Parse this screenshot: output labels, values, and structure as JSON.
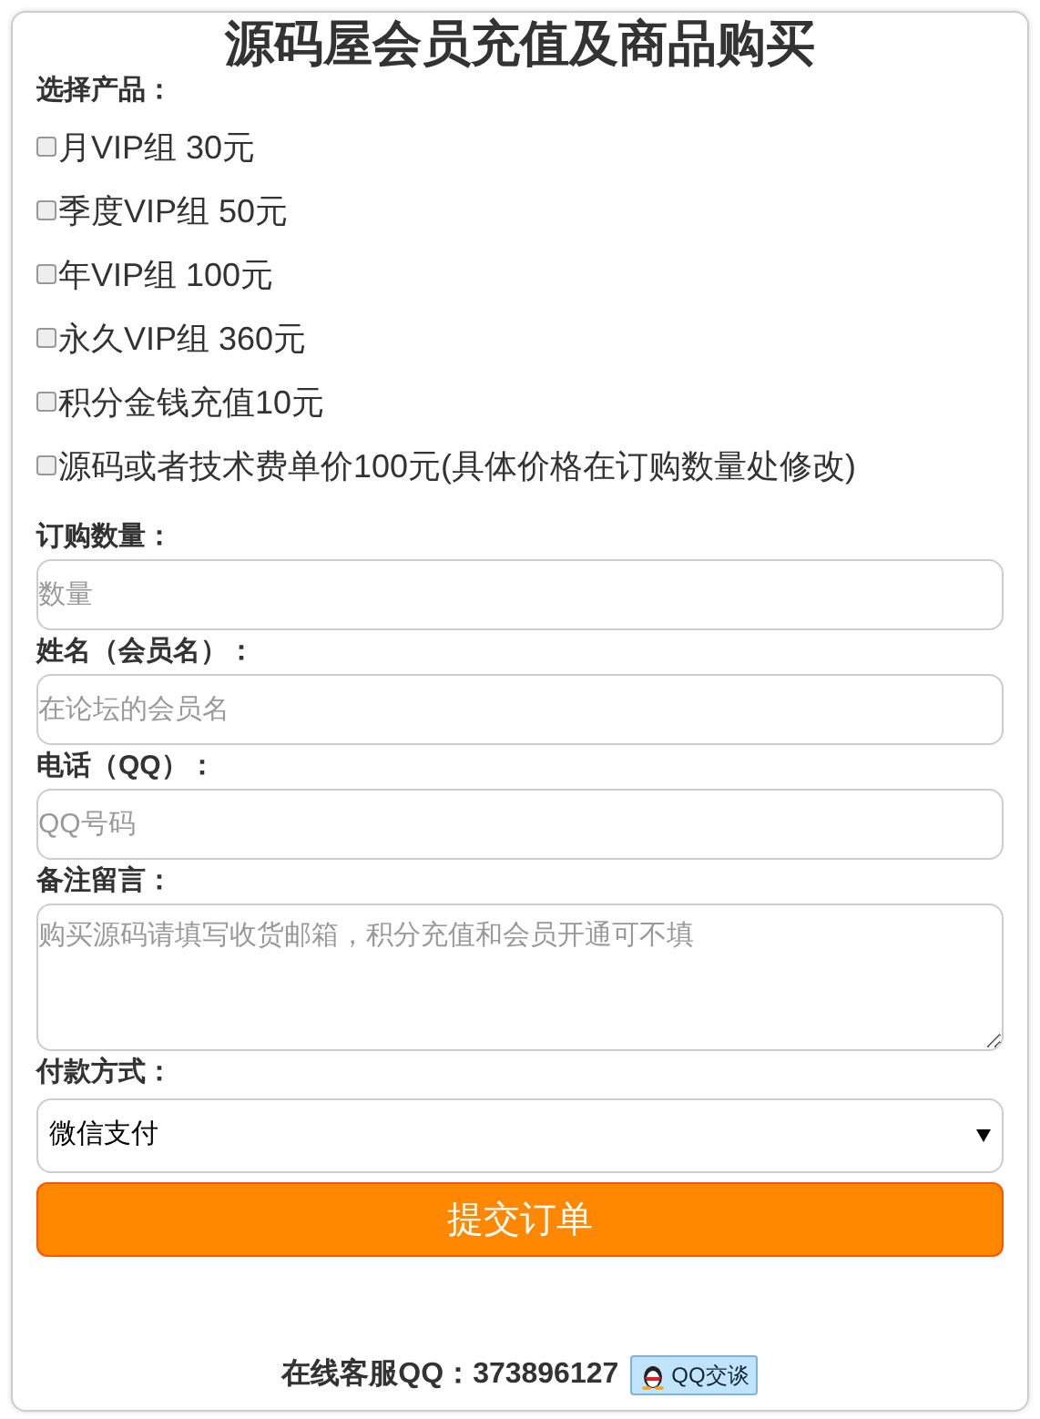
{
  "title": "源码屋会员充值及商品购买",
  "products": {
    "label": "选择产品：",
    "items": [
      {
        "label": "月VIP组 30元",
        "checked": false
      },
      {
        "label": "季度VIP组 50元",
        "checked": false
      },
      {
        "label": "年VIP组 100元",
        "checked": false
      },
      {
        "label": "永久VIP组 360元",
        "checked": false
      },
      {
        "label": "积分金钱充值10元",
        "checked": false
      },
      {
        "label": "源码或者技术费单价100元(具体价格在订购数量处修改)",
        "checked": false
      }
    ]
  },
  "fields": [
    {
      "kind": "input",
      "label": "订购数量：",
      "placeholder": "数量"
    },
    {
      "kind": "input",
      "label": "姓名（会员名）：",
      "placeholder": "在论坛的会员名"
    },
    {
      "kind": "input",
      "label": "电话（QQ）：",
      "placeholder": "QQ号码"
    },
    {
      "kind": "textarea",
      "label": "备注留言：",
      "placeholder": "购买源码请填写收货邮箱，积分充值和会员开通可不填"
    }
  ],
  "payment": {
    "label": "付款方式：",
    "value": "微信支付"
  },
  "submit": "提交订单",
  "footer": {
    "text": "在线客服QQ：373896127",
    "chat_button": "QQ交谈"
  }
}
